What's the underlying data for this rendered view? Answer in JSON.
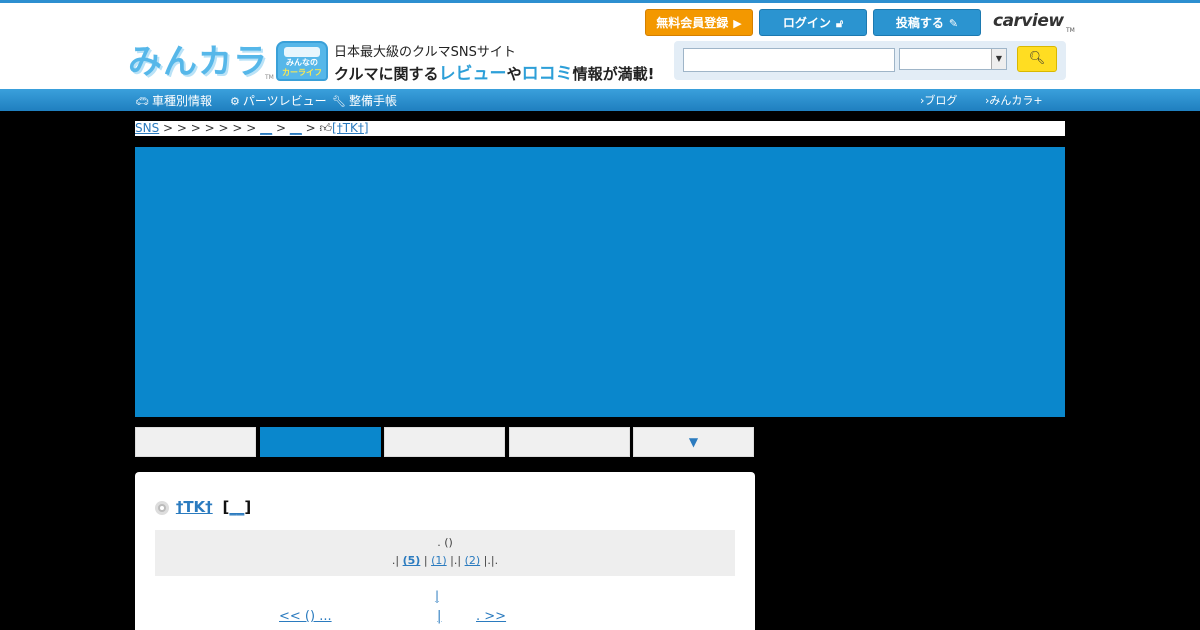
{
  "header": {
    "logo_text": "みんカラ",
    "logo_tm": "TM",
    "badge_line1": "みんなの",
    "badge_line2": "カーライフ",
    "tagline1": "日本最大級のクルマSNSサイト",
    "tagline2_a": "クルマに関する",
    "tagline2_b": "レビュー",
    "tagline2_c": "や",
    "tagline2_d": "ロコミ",
    "tagline2_e": "情報が満載!",
    "register_label": "無料会員登録",
    "login_label": "ログイン",
    "post_label": "投稿する",
    "carview_label": "carview",
    "carview_tm": "TM",
    "search_placeholder": "",
    "search_select_value": ""
  },
  "nav": {
    "car_label": "車種別情報",
    "parts_label": "パーツレビュー",
    "maint_label": "整備手帳",
    "blog_label": "ブログ",
    "minkara_label": "みんカラ+"
  },
  "breadcrumb": {
    "root": "SNS",
    "sep_run": " > > > > > > > ",
    "link1": "__",
    "sep2": " > ",
    "link2": "__",
    "sep3": " > ",
    "current": "[†TK†]"
  },
  "tabs": {
    "more_label": "▼"
  },
  "profile": {
    "user_name": "†TK†",
    "bracket_open": "[",
    "bracket_link": "__",
    "bracket_close": "]"
  },
  "info": {
    "line1": ". ()",
    "prefix": ".|",
    "count1": "(5)",
    "sep1": "|",
    "count2": "(1)",
    "sep2": "|.|",
    "count3": "(2)",
    "suffix": "|.|."
  },
  "pager": {
    "top_link": "|",
    "prev_label": "<< () ...",
    "mid_label": "|",
    "next_label": ". >>"
  },
  "colors": {
    "accent_blue": "#2b94d0",
    "register_orange": "#f39800",
    "banner_blue": "#0a87cc",
    "search_yellow": "#ffdd22"
  }
}
